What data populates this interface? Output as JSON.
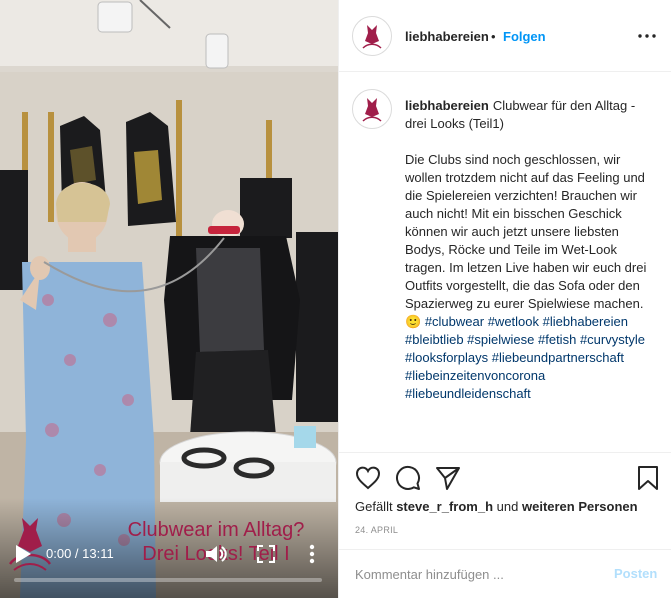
{
  "account": {
    "username": "liebhabereien",
    "dot": "•",
    "follow_label": "Folgen"
  },
  "post": {
    "caption_title": "Clubwear für den Alltag - drei Looks (Teil1)",
    "caption_body": "Die Clubs sind noch geschlossen, wir wollen trotzdem nicht auf das Feeling und die Spielereien verzichten! Brauchen wir auch nicht! Mit ein bisschen Geschick können wir auch jetzt unsere liebsten Bodys, Röcke und Teile im Wet-Look tragen. Im letzen Live haben wir euch drei Outfits vorgestellt, die das Sofa oder den Spazierweg zu eurer Spielwiese machen. 🙂",
    "hashtags": [
      "#clubwear",
      "#wetlook",
      "#liebhabereien",
      "#bleibtlieb",
      "#spielwiese",
      "#fetish",
      "#curvystyle",
      "#looksforplays",
      "#liebeundpartnerschaft",
      "#liebeinzeitenvoncorona",
      "#liebeundleidenschaft"
    ],
    "likes_prefix": "Gefällt",
    "likes_user": "steve_r_from_h",
    "likes_middle": "und",
    "likes_suffix": "weiteren Personen",
    "date": "24. APRIL"
  },
  "video": {
    "overlay_line1": "Clubwear im Alltag?",
    "overlay_line2": "Drei Looks! Teil I",
    "time": "0:00 / 13:11",
    "progress": 0.0
  },
  "comment": {
    "placeholder": "Kommentar hinzufügen ...",
    "post_label": "Posten"
  },
  "icons": {
    "play": "play-icon",
    "volume": "volume-icon",
    "fullscreen": "fullscreen-icon",
    "more": "more-vertical-icon",
    "heart": "heart-icon",
    "comment": "comment-icon",
    "share": "share-icon",
    "bookmark": "bookmark-icon"
  },
  "colors": {
    "link": "#00376b",
    "follow": "#0095f6",
    "post_disabled": "#b2dffc",
    "brand": "#a01e4a"
  }
}
